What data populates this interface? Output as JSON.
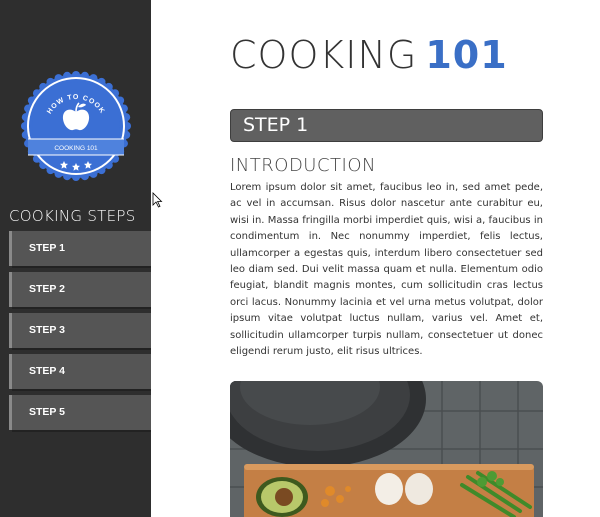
{
  "sidebar": {
    "badge": {
      "top_text": "HOW TO COOK",
      "ribbon_text": "COOKING 101",
      "icon": "apple-icon",
      "colors": {
        "fill": "#3b6fd4",
        "ring": "#ffffff"
      }
    },
    "steps_title": "COOKING STEPS",
    "steps": [
      {
        "label": "STEP 1"
      },
      {
        "label": "STEP 2"
      },
      {
        "label": "STEP 3"
      },
      {
        "label": "STEP 4"
      },
      {
        "label": "STEP 5"
      }
    ]
  },
  "main": {
    "title_prefix": "COOKING",
    "title_accent": "101",
    "step_bar_label": "STEP 1",
    "section_title": "INTRODUCTION",
    "body": "Lorem ipsum dolor sit amet, faucibus leo in, sed amet pede, ac vel in accumsan. Risus dolor nascetur ante curabitur eu, wisi in. Massa fringilla morbi imperdiet quis, wisi a, faucibus in condimentum in. Nec nonummy imperdiet, felis lectus, ullamcorper a egestas quis, interdum libero consectetuer sed leo diam sed. Dui velit massa quam et nulla. Elementum odio feugiat, blandit magnis montes, cum sollicitudin cras lectus orci lacus. Nonummy lacinia et vel urna metus volutpat, dolor ipsum vitae volutpat luctus nullam, varius vel. Amet et, sollicitudin ullamcorper turpis nullam, consectetuer ut donec eligendi rerum justo, elit risus ultrices.",
    "photo": "cooking-ingredients-photo"
  },
  "colors": {
    "sidebar_bg": "#2e2e2e",
    "accent": "#3a6fc6",
    "step_item_bg": "#555555",
    "step_bar_bg": "#606060"
  }
}
